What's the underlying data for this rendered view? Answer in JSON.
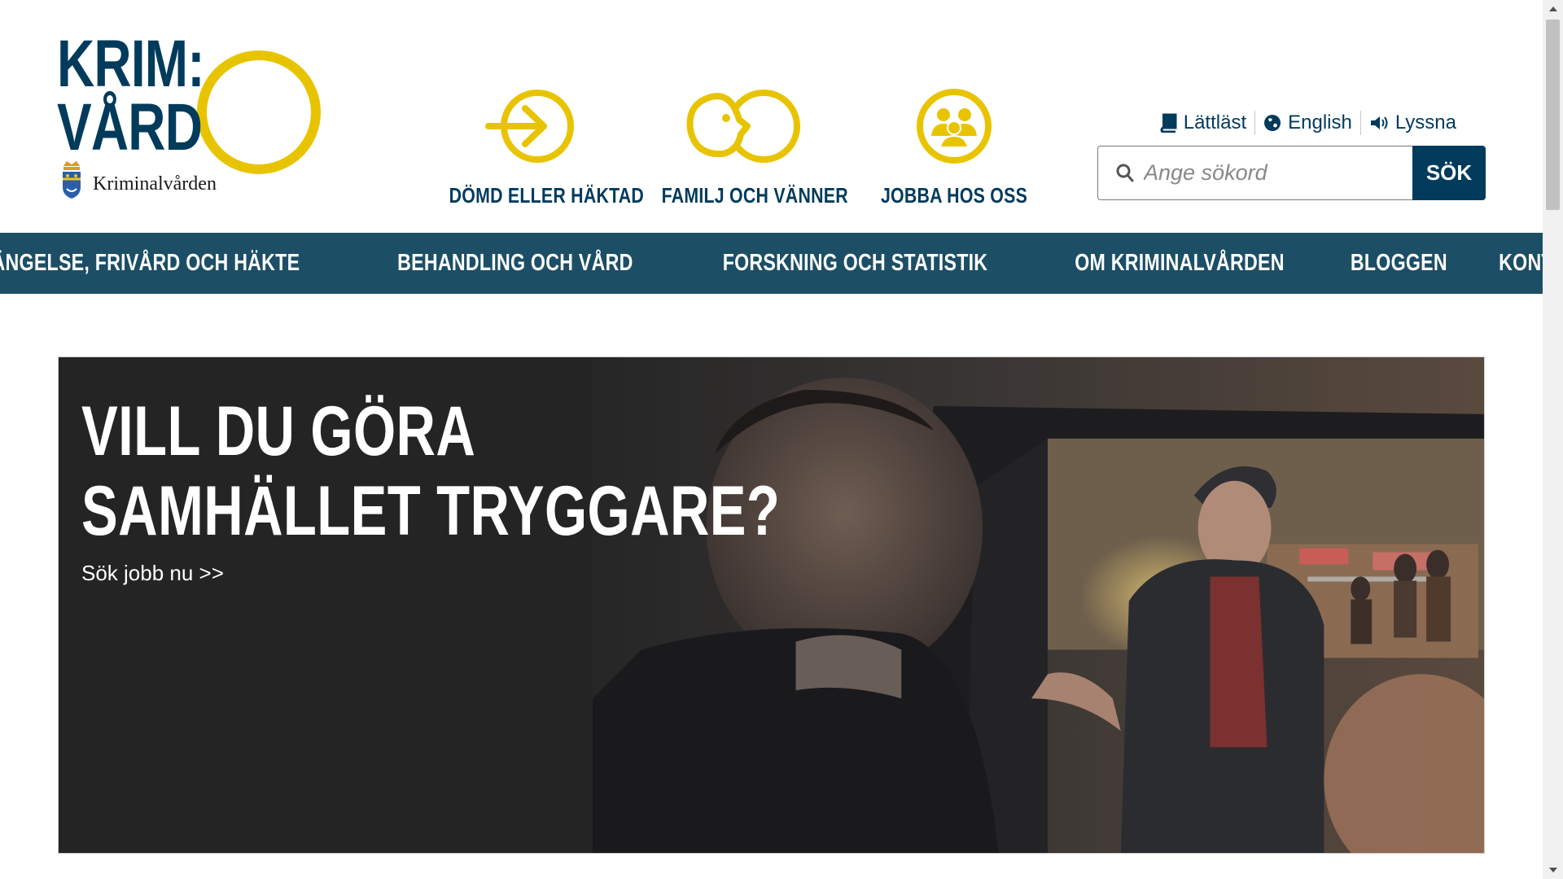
{
  "logo": {
    "line1": "KRIM:",
    "line2": "VÅRD",
    "agency": "Kriminalvården",
    "ring_color": "#e8c400",
    "text_color": "#003b5c"
  },
  "quick_links": [
    {
      "label": "DÖMD ELLER HÄKTAD",
      "icon": "arrow-into-circle-icon"
    },
    {
      "label": "FAMILJ OCH VÄNNER",
      "icon": "two-circles-face-icon"
    },
    {
      "label": "JOBBA HOS OSS",
      "icon": "group-people-icon"
    }
  ],
  "utility": {
    "easy_read": "Lättläst",
    "english": "English",
    "listen": "Lyssna"
  },
  "search": {
    "placeholder": "Ange sökord",
    "button": "SÖK"
  },
  "nav": {
    "items": [
      "FÄNGELSE, FRIVÅRD OCH HÄKTE",
      "BEHANDLING OCH VÅRD",
      "FORSKNING OCH STATISTIK",
      "OM KRIMINALVÅRDEN",
      "BLOGGEN",
      "KONTAKT"
    ]
  },
  "hero": {
    "title_line1": "VILL DU GÖRA",
    "title_line2": "SAMHÄLLET TRYGGARE?",
    "link": "Sök jobb nu >>"
  },
  "colors": {
    "primary": "#003b5c",
    "nav_bg": "#1c4e66",
    "accent": "#e8c400",
    "hero_bg": "#242424"
  }
}
